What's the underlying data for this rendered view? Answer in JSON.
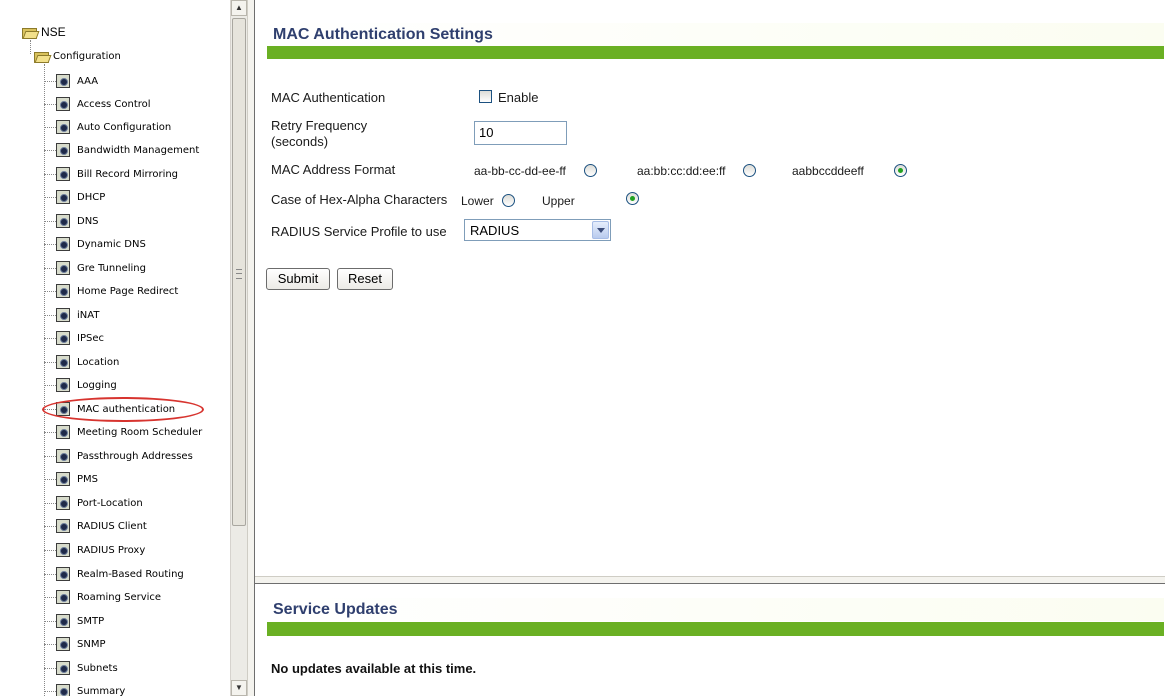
{
  "tree": {
    "root_label": "NSE",
    "folder_label": "Configuration",
    "items": [
      {
        "label": "AAA"
      },
      {
        "label": "Access Control"
      },
      {
        "label": "Auto Configuration"
      },
      {
        "label": "Bandwidth Management"
      },
      {
        "label": "Bill Record Mirroring"
      },
      {
        "label": "DHCP"
      },
      {
        "label": "DNS"
      },
      {
        "label": "Dynamic DNS"
      },
      {
        "label": "Gre Tunneling"
      },
      {
        "label": "Home Page Redirect"
      },
      {
        "label": "iNAT"
      },
      {
        "label": "IPSec"
      },
      {
        "label": "Location"
      },
      {
        "label": "Logging"
      },
      {
        "label": "MAC authentication"
      },
      {
        "label": "Meeting Room Scheduler"
      },
      {
        "label": "Passthrough Addresses"
      },
      {
        "label": "PMS"
      },
      {
        "label": "Port-Location"
      },
      {
        "label": "RADIUS Client"
      },
      {
        "label": "RADIUS Proxy"
      },
      {
        "label": "Realm-Based Routing"
      },
      {
        "label": "Roaming Service"
      },
      {
        "label": "SMTP"
      },
      {
        "label": "SNMP"
      },
      {
        "label": "Subnets"
      },
      {
        "label": "Summary"
      }
    ],
    "highlighted_item": "MAC authentication"
  },
  "settings": {
    "title": "MAC Authentication Settings",
    "mac_auth_label": "MAC Authentication",
    "mac_auth_enable_label": "Enable",
    "mac_auth_enabled": false,
    "retry_label_line1": "Retry Frequency",
    "retry_label_line2": "(seconds)",
    "retry_value": "10",
    "mac_format_label": "MAC Address Format",
    "mac_format_options": [
      "aa-bb-cc-dd-ee-ff",
      "aa:bb:cc:dd:ee:ff",
      "aabbccddeeff"
    ],
    "mac_format_selected": "aabbccddeeff",
    "case_label": "Case of Hex-Alpha Characters",
    "case_options": [
      "Lower",
      "Upper"
    ],
    "case_selected": "Upper",
    "radius_label": "RADIUS Service Profile to use",
    "radius_value": "RADIUS",
    "submit_label": "Submit",
    "reset_label": "Reset"
  },
  "updates": {
    "title": "Service Updates",
    "message": "No updates available at this time."
  },
  "colors": {
    "header_bar": "#6ab023",
    "title_text": "#2f3f6e",
    "highlight_ring": "#d7342f"
  }
}
